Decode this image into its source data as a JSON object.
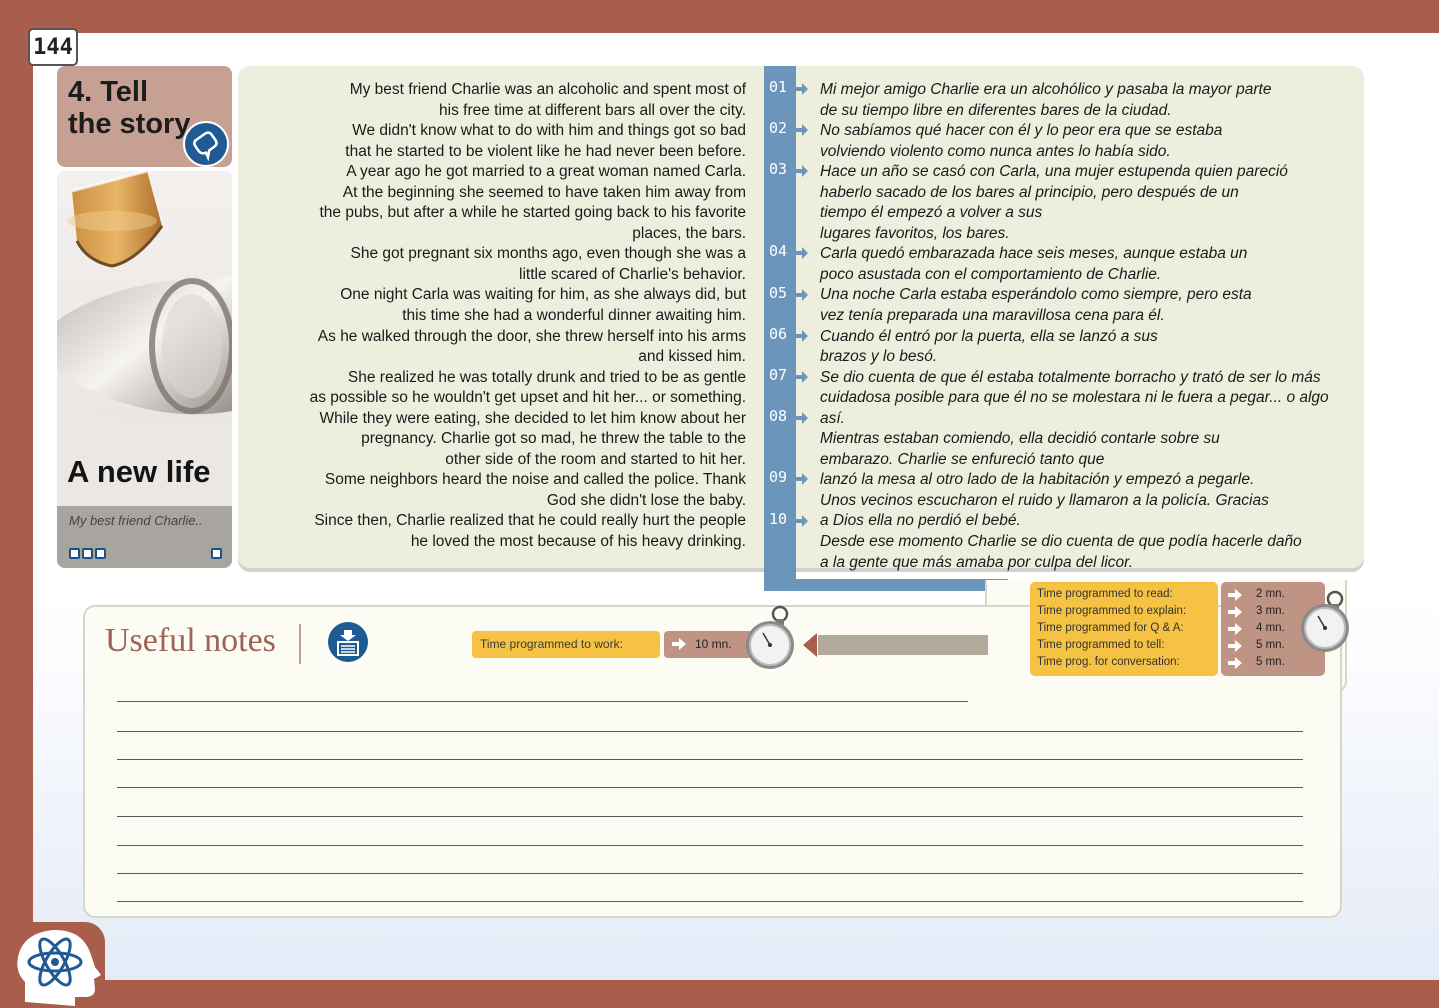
{
  "page_number": "144",
  "section": {
    "title": "4. Tell\nthe story",
    "icon": "speech-bubble-icon"
  },
  "story": {
    "title": "A new life",
    "caption": "My best friend Charlie.."
  },
  "english_lines": [
    "My best friend Charlie was an alcoholic and spent most of",
    "his free time at different bars all over the city.",
    "We didn't know what to do with him and things got so bad",
    "that he started to be violent like he had never been before.",
    "A year ago he got married to a great woman named Carla.",
    "At the beginning she seemed to have taken him away from",
    "the pubs, but after a while he started going back to his favorite",
    "places, the bars.",
    "She got pregnant six months ago, even though she was a",
    "little scared of Charlie's behavior.",
    "One night Carla was waiting for him, as she always did, but",
    "this time she had a wonderful dinner awaiting him.",
    "As he walked through the door, she threw herself into his arms",
    "and kissed him.",
    "She realized he was totally drunk and tried to be as gentle",
    "as possible so he wouldn't get upset and hit her... or something.",
    "While they were eating, she decided to let him know about her",
    "pregnancy. Charlie got so mad, he threw the table to the",
    "other side of the room and started to hit her.",
    "Some neighbors heard the noise and called the police. Thank",
    "God she didn't lose the baby.",
    "Since then, Charlie realized that he could really hurt the people",
    "he loved the most because of his heavy drinking."
  ],
  "spanish_lines": [
    "Mi mejor amigo Charlie era un alcohólico y pasaba la mayor parte",
    "de su tiempo libre en diferentes bares de la ciudad.",
    "No sabíamos qué hacer con él y lo peor era que se estaba",
    "volviendo violento como nunca antes lo había sido.",
    "Hace un año se casó con Carla, una mujer estupenda quien pareció",
    "haberlo sacado de los bares al principio, pero después de un",
    "tiempo él empezó a volver a sus",
    "lugares favoritos, los bares.",
    "Carla quedó embarazada hace seis meses, aunque estaba un",
    "poco asustada con el comportamiento de Charlie.",
    "Una noche Carla estaba esperándolo como siempre, pero esta",
    "vez tenía preparada una maravillosa cena para él.",
    "Cuando él entró por la puerta, ella se lanzó a sus",
    "brazos y lo besó.",
    "Se dio cuenta de que él estaba totalmente borracho y trató de ser lo más",
    "cuidadosa posible para que él no se molestara ni le fuera a pegar... o algo así.",
    "Mientras estaban comiendo, ella decidió contarle sobre su",
    "embarazo. Charlie se enfureció tanto que",
    "lanzó la mesa al otro lado de la habitación y empezó a pegarle.",
    "Unos vecinos escucharon el ruido y llamaron a la policía. Gracias",
    "a Dios ella no perdió el bebé.",
    "Desde ese momento Charlie se dio cuenta de que podía hacerle daño",
    "a la gente que más amaba por culpa del licor."
  ],
  "paragraph_numbers": [
    "01",
    "02",
    "03",
    "04",
    "05",
    "06",
    "07",
    "08",
    "09",
    "10"
  ],
  "notes": {
    "title": "Useful notes",
    "icon": "notepad-icon"
  },
  "work": {
    "label": "Time programmed to work:",
    "value": "10 mn."
  },
  "program": {
    "labels": [
      "Time programmed to read:",
      "Time programmed to explain:",
      "Time programmed for Q & A:",
      "Time programmed to tell:",
      "Time prog. for conversation:"
    ],
    "values": [
      "2 mn.",
      "3 mn.",
      "4 mn.",
      "5 mn.",
      "5 mn."
    ]
  },
  "colors": {
    "frame": "#a85e4b",
    "accent_blue": "#1f5a93",
    "bar_blue": "#6c95bc",
    "yellow": "#f5c244",
    "tan": "#bf9485"
  }
}
